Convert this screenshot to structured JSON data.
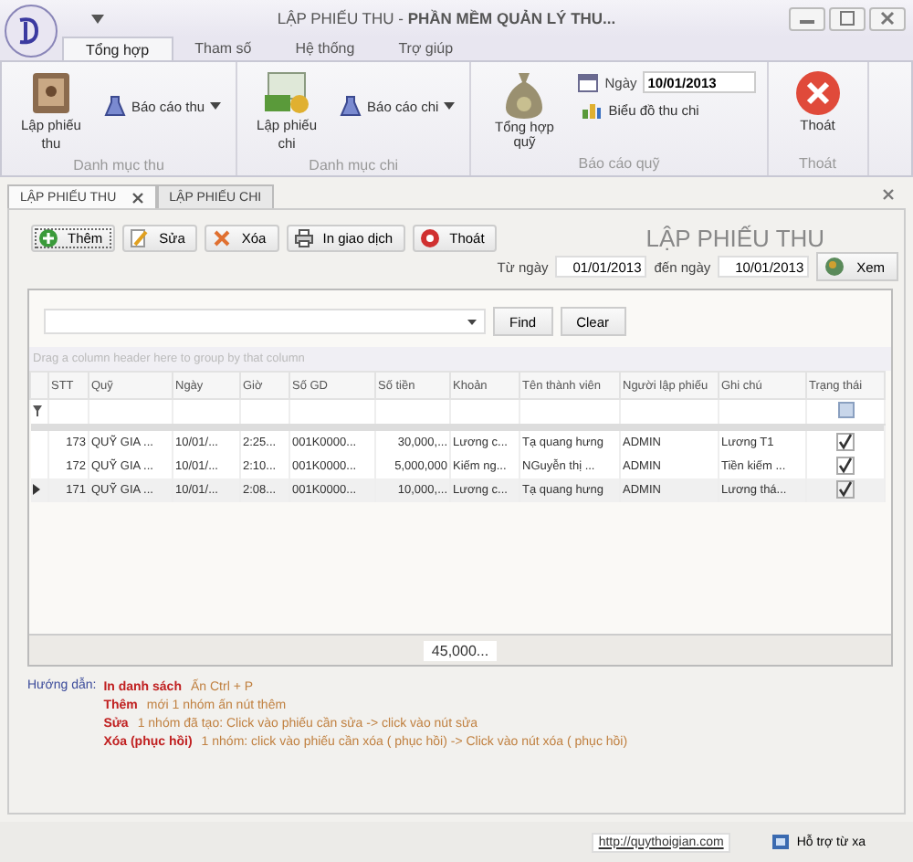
{
  "window": {
    "title": "LẬP PHIẾU THU - **PHẦN MỀM QUẢN LÝ THU...**"
  },
  "ribbon": {
    "tabs": [
      {
        "label": "Tổng hợp",
        "selected": true
      },
      {
        "label": "Tham số",
        "selected": false
      },
      {
        "label": "Hệ thống",
        "selected": false
      },
      {
        "label": "Trợ giúp",
        "selected": false
      }
    ],
    "groups": [
      {
        "label": "Danh mục thu",
        "items": [
          {
            "kind": "large",
            "label": "Lập phiếu thu"
          },
          {
            "kind": "dropdown",
            "label": "Báo cáo thu"
          }
        ]
      },
      {
        "label": "Danh mục chi",
        "items": [
          {
            "kind": "large",
            "label": "Lập phiếu chi"
          },
          {
            "kind": "dropdown",
            "label": "Báo cáo chi"
          }
        ]
      },
      {
        "label": "Báo cáo quỹ",
        "items": [
          {
            "kind": "large",
            "label": "Tổng hợp quỹ"
          },
          {
            "kind": "stack",
            "date_label": "Ngày",
            "date_value": "10/01/2013",
            "label": "Biểu đồ thu chi"
          }
        ]
      },
      {
        "label": "Thoát",
        "items": [
          {
            "kind": "large",
            "label": "Thoát"
          }
        ]
      }
    ]
  },
  "doc_tabs": [
    {
      "label": "LẬP PHIẾU THU",
      "selected": true,
      "closable": true
    },
    {
      "label": "LẬP PHIẾU CHI",
      "selected": false,
      "closable": false
    }
  ],
  "toolbar": [
    "Thêm",
    "Sửa",
    "Xóa",
    "In giao dịch",
    "Thoát"
  ],
  "form_title": "LẬP PHIẾU THU",
  "date_range": {
    "from_label": "Từ ngày",
    "from": "01/01/2013",
    "to_label": "đến ngày",
    "to": "10/01/2013",
    "view_button": "Xem"
  },
  "search": {
    "find": "Find",
    "clear": "Clear"
  },
  "grid": {
    "group_hint": "Drag a column header here to group by that column",
    "columns": [
      "STT",
      "Quỹ",
      "Ngày",
      "Giờ",
      "Số GD",
      "Số tiền",
      "Khoản",
      "Tên thành viên",
      "Người lập phiếu",
      "Ghi chú",
      "Trạng thái"
    ],
    "rows": [
      {
        "cells": [
          "173",
          "QUỸ GIA ...",
          "10/01/...",
          "2:25...",
          "001K0000...",
          "30,000,...",
          "Lương c...",
          "Tạ quang hưng",
          "ADMIN",
          "Lương T1"
        ],
        "checked": true,
        "selected": false
      },
      {
        "cells": [
          "172",
          "QUỸ GIA ...",
          "10/01/...",
          "2:10...",
          "001K0000...",
          "5,000,000",
          "Kiếm ng...",
          "NGuyễn thị ...",
          "ADMIN",
          "Tiền kiếm ..."
        ],
        "checked": true,
        "selected": false
      },
      {
        "cells": [
          "171",
          "QUỸ GIA ...",
          "10/01/...",
          "2:08...",
          "001K0000...",
          "10,000,...",
          "Lương c...",
          "Tạ quang hưng",
          "ADMIN",
          "Lương thá..."
        ],
        "checked": true,
        "selected": true
      }
    ],
    "total": "45,000..."
  },
  "hints": {
    "label": "Hướng dẫn:",
    "lines": [
      {
        "key": "In danh sách",
        "text": "Ấn Ctrl + P"
      },
      {
        "key": "Thêm",
        "text": "mới 1 nhóm ấn nút thêm"
      },
      {
        "key": "Sửa",
        "text": "1 nhóm đã tạo: Click vào phiếu cần sửa  ->  click vào nút sửa"
      },
      {
        "key": "Xóa (phục hồi)",
        "text": "1 nhóm: click vào phiếu cần xóa ( phục hồi)  -> Click vào nút xóa ( phục hồi)"
      }
    ]
  },
  "status_bar": {
    "link": "http://quythoigian.com",
    "support": "Hỗ trợ từ xa"
  }
}
